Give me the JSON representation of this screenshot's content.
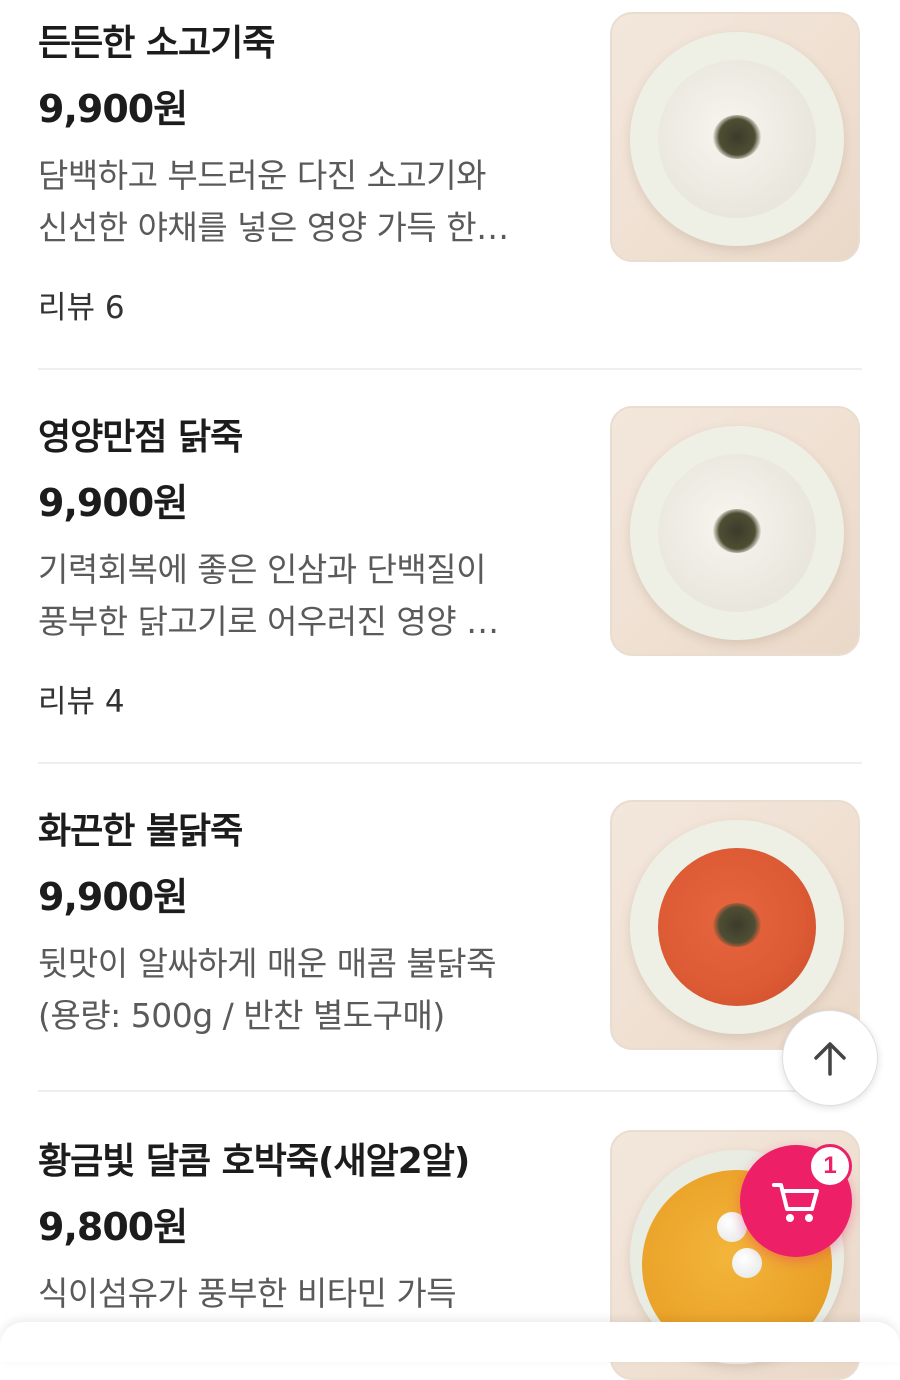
{
  "menu_items": [
    {
      "name": "든든한 소고기죽",
      "price": "9,900원",
      "desc_line1": "담백하고 부드러운 다진 소고기와",
      "desc_line2": "신선한 야채를 넣은 영양 가득 한…",
      "review": "리뷰 6"
    },
    {
      "name": "영양만점 닭죽",
      "price": "9,900원",
      "desc_line1": "기력회복에 좋은 인삼과 단백질이",
      "desc_line2": "풍부한 닭고기로 어우러진 영양 …",
      "review": "리뷰 4"
    },
    {
      "name": "화끈한 불닭죽",
      "price": "9,900원",
      "desc_line1": "뒷맛이 알싸하게 매운 매콤 불닭죽",
      "desc_line2": "(용량: 500g / 반찬 별도구매)"
    },
    {
      "name": "황금빛 달콤 호박죽(새알2알)",
      "price": "9,800원",
      "desc_line1": "식이섬유가 풍부한 비타민 가득"
    }
  ],
  "cart": {
    "badge_count": "1",
    "accent_color": "#ec1f67"
  },
  "icons": {
    "scroll_top": "arrow-up-icon",
    "cart": "cart-icon"
  }
}
